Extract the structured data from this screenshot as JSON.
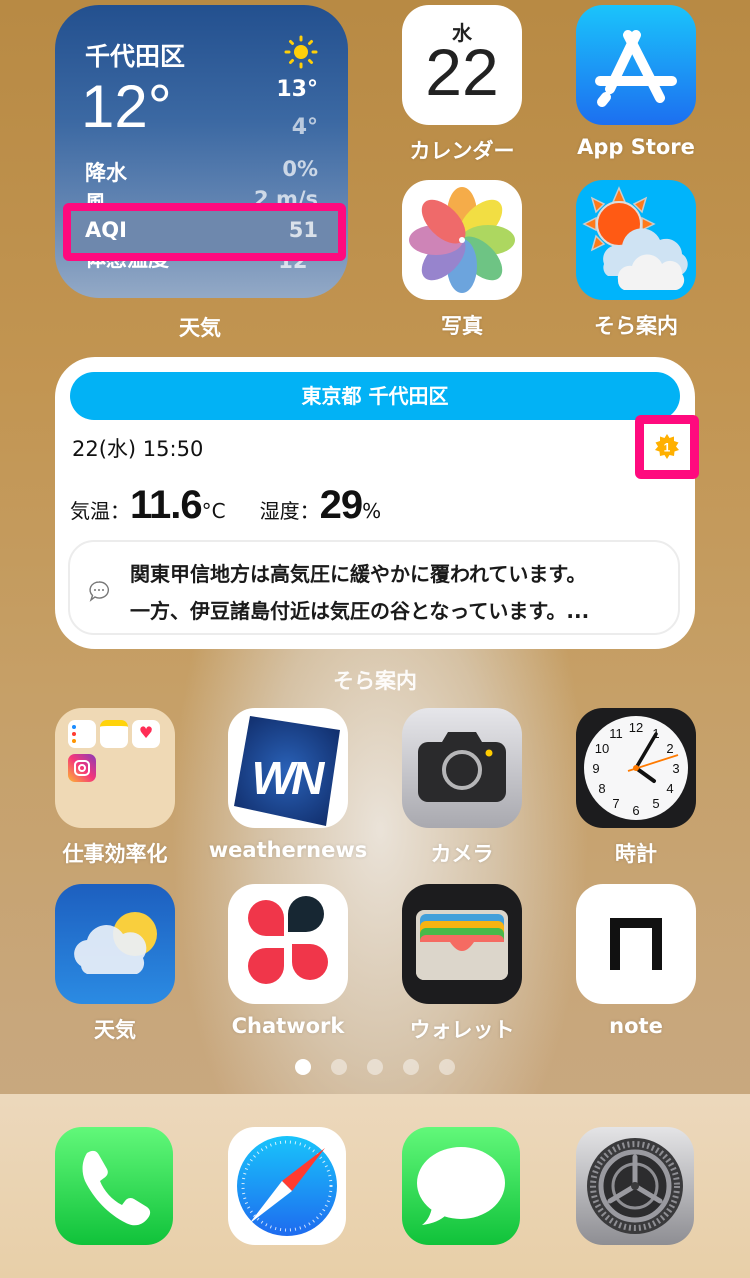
{
  "weather_widget": {
    "city": "千代田区",
    "current_temp": "12°",
    "condition_icon": "sun-icon",
    "high": "13°",
    "low": "4°",
    "rows": [
      {
        "label": "降水",
        "value": "0%"
      },
      {
        "label": "風",
        "value": "2 m/s"
      },
      {
        "label": "AQI",
        "value": "51"
      },
      {
        "label": "体感温度",
        "value": "12°"
      }
    ],
    "app_label": "天気",
    "highlight_color": "#ff0a7e"
  },
  "top_apps": [
    {
      "name": "calendar",
      "label": "カレンダー",
      "weekday": "水",
      "day": "22"
    },
    {
      "name": "app-store",
      "label": "App Store"
    },
    {
      "name": "photos",
      "label": "写真"
    },
    {
      "name": "sora-annai",
      "label": "そら案内"
    }
  ],
  "sora_widget": {
    "location": "東京都 千代田区",
    "datetime": "22(水) 15:50",
    "badge_value": "1",
    "temp_label": "気温：",
    "temp_value": "11.6",
    "temp_unit": "°C",
    "humidity_label": "湿度：",
    "humidity_value": "29",
    "humidity_unit": "%",
    "message_lines": [
      "関東甲信地方は高気圧に緩やかに覆われています。",
      "一方、伊豆諸島付近は気圧の谷となっています。..."
    ],
    "widget_label": "そら案内",
    "accent_color": "#02b2f5"
  },
  "grid_apps": [
    {
      "name": "folder-productivity",
      "label": "仕事効率化"
    },
    {
      "name": "weathernews",
      "label": "weathernews"
    },
    {
      "name": "camera",
      "label": "カメラ"
    },
    {
      "name": "clock",
      "label": "時計"
    },
    {
      "name": "weather",
      "label": "天気"
    },
    {
      "name": "chatwork",
      "label": "Chatwork"
    },
    {
      "name": "wallet",
      "label": "ウォレット"
    },
    {
      "name": "note",
      "label": "note"
    }
  ],
  "page_indicator": {
    "count": 5,
    "active": 1
  },
  "dock": [
    {
      "name": "phone"
    },
    {
      "name": "safari"
    },
    {
      "name": "messages"
    },
    {
      "name": "settings"
    }
  ]
}
